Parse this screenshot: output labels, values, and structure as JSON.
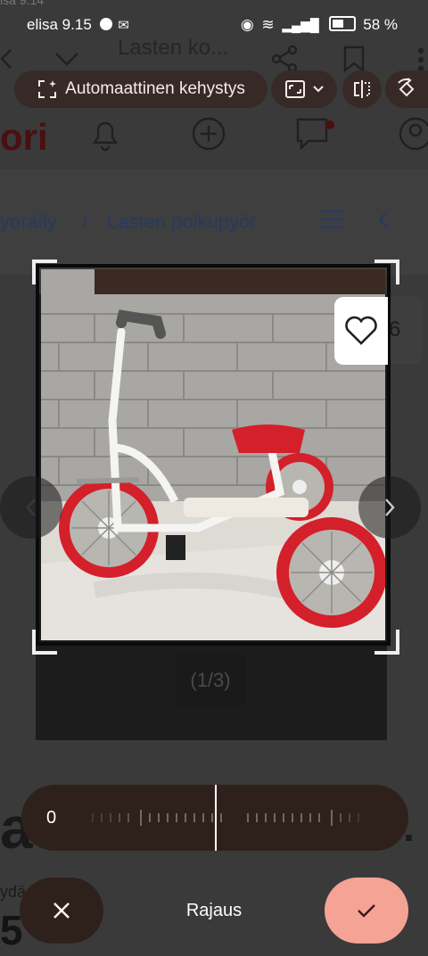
{
  "status_bar": {
    "carrier_time": "elisa 9.15",
    "battery": "58 %",
    "top_fragment": "isa 9.14"
  },
  "background_page": {
    "title_fragment": "Lasten ko...",
    "logo_fragment": "ori",
    "breadcrumb_1": "yöräily",
    "breadcrumb_sep": "/",
    "breadcrumb_2": "Lasten polkupyör",
    "heading_fragment": "a",
    "heading_end": ".",
    "label_fragment": "ydä",
    "price_fragment": "5",
    "favorite_count": "6"
  },
  "toolbar": {
    "auto_frame_label": "Automaattinen kehystys"
  },
  "image_viewer": {
    "counter": "(1/3)"
  },
  "editor": {
    "rotation_value": "0",
    "mode_label": "Rajaus"
  },
  "colors": {
    "pill_bg": "#372a26",
    "confirm_bg": "#f4a394",
    "slider_bg": "#2e211c",
    "bike_red": "#d4202a"
  }
}
